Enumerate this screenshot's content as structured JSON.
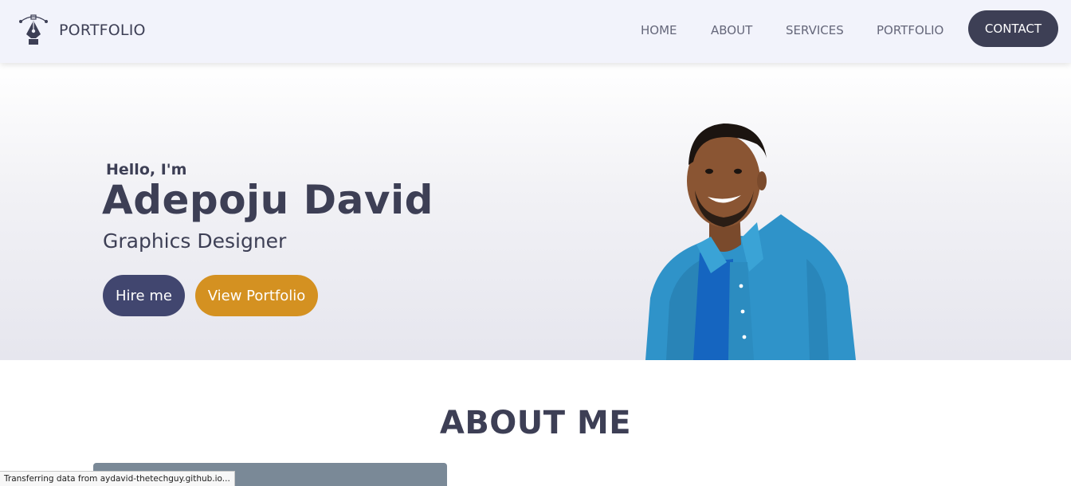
{
  "navbar": {
    "brand_icon": "pen-tool-icon",
    "brand_text": "PORTFOLIO",
    "links": [
      {
        "label": "HOME"
      },
      {
        "label": "ABOUT"
      },
      {
        "label": "SERVICES"
      },
      {
        "label": "PORTFOLIO"
      }
    ],
    "contact_label": "CONTACT"
  },
  "hero": {
    "greeting": "Hello, I'm",
    "name": "Adepoju David",
    "role": "Graphics Designer",
    "hire_label": "Hire me",
    "portfolio_label": "View Portfolio",
    "portrait": "profile-photo"
  },
  "about": {
    "title": "ABOUT ME"
  },
  "status_bar": {
    "text": "Transferring data from aydavid-thetechguy.github.io..."
  },
  "colors": {
    "navbar_bg": "#f2f3fb",
    "primary_dark": "#3d3f55",
    "hire_button": "#41466f",
    "portfolio_button": "#d49121",
    "about_card": "#7a8997"
  }
}
